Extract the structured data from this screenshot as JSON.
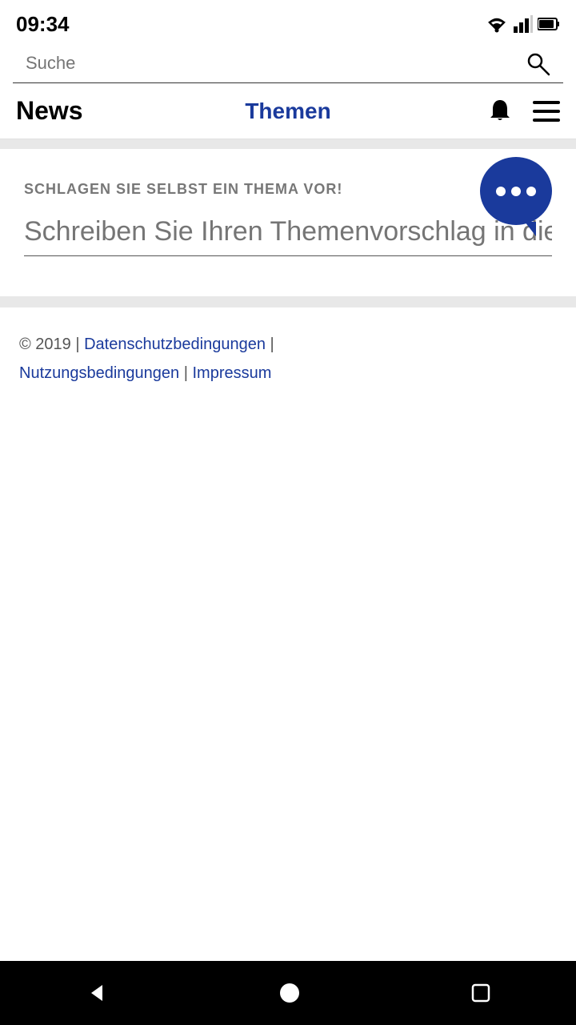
{
  "statusBar": {
    "time": "09:34"
  },
  "search": {
    "placeholder": "Suche"
  },
  "nav": {
    "newsLabel": "News",
    "themenLabel": "Themen"
  },
  "proposal": {
    "sectionLabel": "SCHLAGEN SIE SELBST EIN THEMA VOR!",
    "inputPlaceholder": "Schreiben Sie Ihren Themenvorschlag in diese Zeile"
  },
  "footer": {
    "copyright": "© 2019 |",
    "datenschutz": "Datenschutzbedingungen",
    "separator1": "|",
    "nutzung": "Nutzungsbedingungen",
    "separator2": "|",
    "impressum": "Impressum"
  }
}
